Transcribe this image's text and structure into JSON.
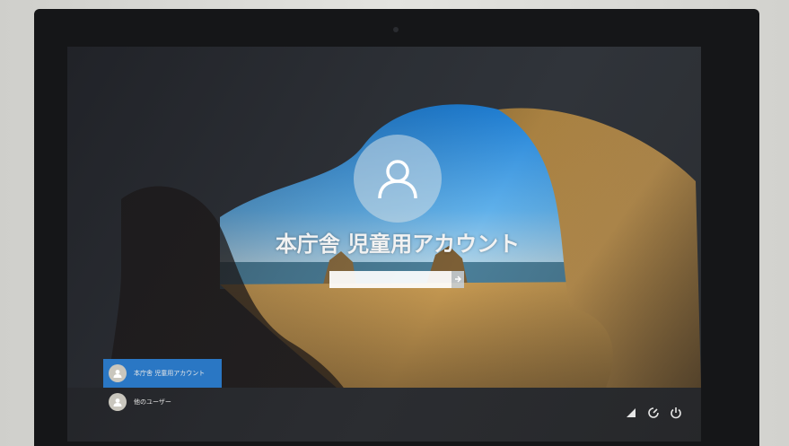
{
  "login": {
    "user_name": "本庁舎 児童用アカウント",
    "password_value": "",
    "password_placeholder": ""
  },
  "user_list": [
    {
      "label": "本庁舎 児童用アカウント",
      "selected": true
    },
    {
      "label": "他のユーザー",
      "selected": false
    }
  ],
  "tray": {
    "icons": [
      "network-icon",
      "ease-of-access-icon",
      "power-icon"
    ]
  },
  "colors": {
    "selected_user_bg": "#2a77c4",
    "text": "#f2f2f2"
  }
}
